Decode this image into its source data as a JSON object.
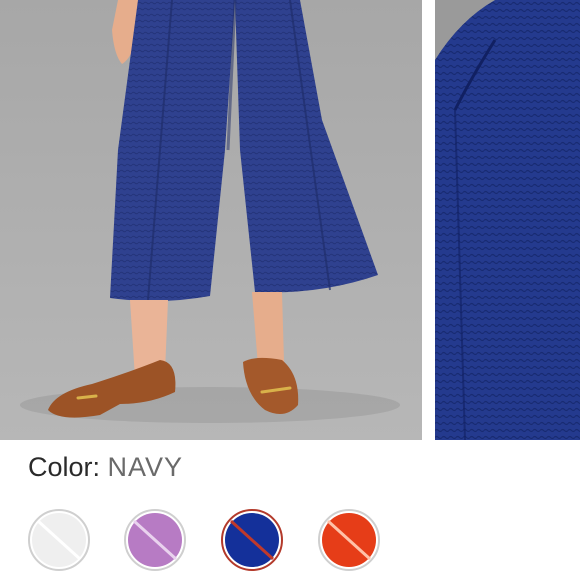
{
  "product": {
    "color_prefix": "Color:",
    "color_value": "NAVY"
  },
  "swatches": [
    {
      "name": "white",
      "color": "#efefef",
      "selected": false,
      "unavailable": true
    },
    {
      "name": "lilac",
      "color": "#b77bc4",
      "selected": false,
      "unavailable": true
    },
    {
      "name": "navy",
      "color": "#14309a",
      "selected": true,
      "unavailable": true
    },
    {
      "name": "red-orange",
      "color": "#e63d18",
      "selected": false,
      "unavailable": true
    }
  ],
  "colors": {
    "pants_navy": "#2d3e8c",
    "shoe_suede": "#9c5326",
    "backdrop_gray": "#a9a9a9",
    "selected_ring": "#b33a2b",
    "strike": "#c0392b"
  }
}
